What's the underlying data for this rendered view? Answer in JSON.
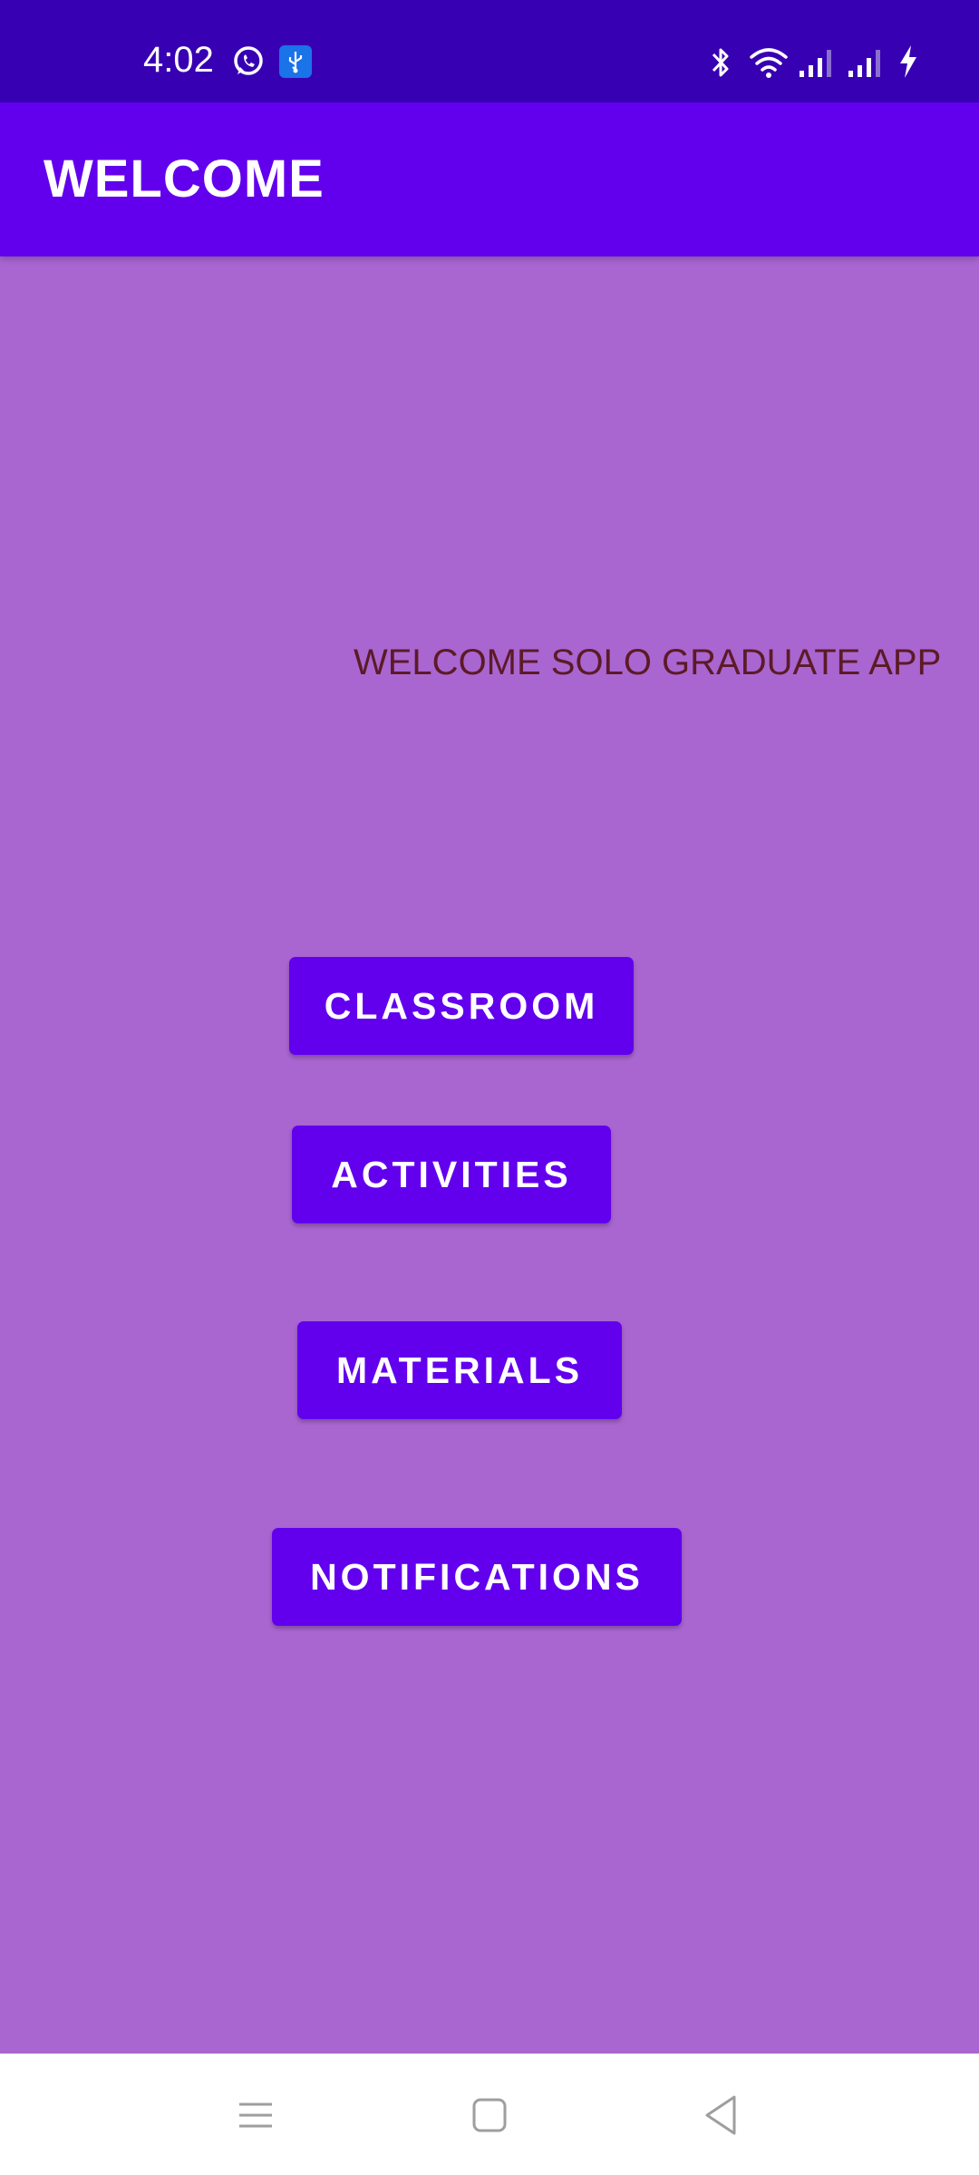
{
  "status_bar": {
    "time": "4:02",
    "left_icons": [
      "whatsapp-icon",
      "usb-icon"
    ],
    "right_icons": [
      "bluetooth-icon",
      "wifi-icon",
      "signal-icon",
      "signal-icon",
      "charging-icon"
    ]
  },
  "app_bar": {
    "title": "WELCOME"
  },
  "main": {
    "welcome_message": "WELCOME SOLO GRADUATE APP",
    "buttons": [
      {
        "label": "CLASSROOM"
      },
      {
        "label": "ACTIVITIES"
      },
      {
        "label": "MATERIALS"
      },
      {
        "label": "NOTIFICATIONS"
      }
    ]
  },
  "nav_bar": {
    "icons": [
      "menu-icon",
      "home-icon",
      "back-icon"
    ]
  },
  "colors": {
    "status_bar": "#3700b3",
    "app_bar": "#6200ee",
    "background": "#a966d1",
    "button": "#6200ee",
    "welcome_text": "#5c1a26"
  }
}
